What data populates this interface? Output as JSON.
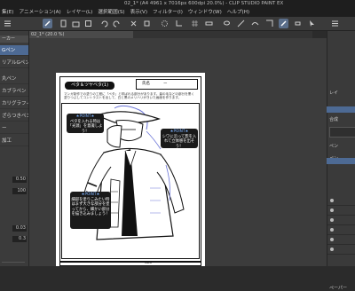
{
  "window": {
    "title": "02_1* (A4 4961 x 7016px 600dpi 20.0%) - CLIP STUDIO PAINT EX"
  },
  "menu": [
    "集(E)",
    "アニメーション(A)",
    "レイヤー(L)",
    "選択範囲(S)",
    "表示(V)",
    "フィルター(I)",
    "ウィンドウ(W)",
    "ヘルプ(H)"
  ],
  "tab": {
    "label": "02_1* (20.0 %)"
  },
  "left_panel": {
    "header": "ーカー",
    "items": [
      "Gペン",
      "リアルGペン",
      "丸ペン",
      "カブラペン",
      "カリグラフィ",
      "ざらつきペン",
      "ー ",
      "加工"
    ],
    "selected_index": 0,
    "props": [
      {
        "label": "",
        "value": "0.50"
      },
      {
        "label": "",
        "value": "100"
      },
      {
        "label": "",
        "value": "0.03"
      },
      {
        "label": "",
        "value": "0.3"
      }
    ]
  },
  "page": {
    "title_box": "ペタ＆ツヤベタ(1)",
    "top_note": "マンガ制作での塗りの工程に「ペタ」と呼ばれる部分があります。髪の毛などの部分を黒く塗りつぶしてコントラストを出して、白と黒のメリハリがきいた画面を作ります。",
    "point_label": "★POINT★",
    "points": [
      "ペタを入れる時は「光源」を意識しよう！",
      "シワに沿って影を入れて立体感を出そう！",
      "細部を塗りこみたい時はまず大きな部分を塗ってから、細かい部分を描き込みましょう！"
    ],
    "header_box": "氏名",
    "header_label": "ー",
    "plate": "No.2"
  },
  "right_panel": {
    "labels": [
      "レイ",
      "合成",
      "ペン",
      "ペン"
    ],
    "bottom_label": "ペーパー"
  },
  "colors": {
    "accent": "#4d6a94",
    "app_bg": "#2b2b2b",
    "point_text": "#7fb3ff",
    "sketch_blue": "#6b75d8"
  }
}
